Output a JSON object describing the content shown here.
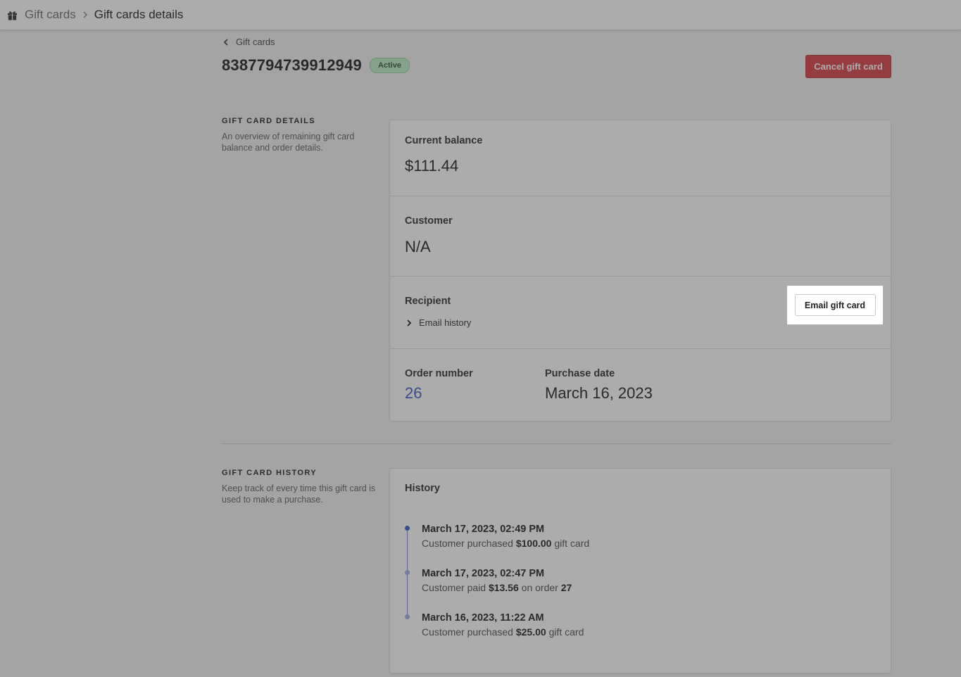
{
  "breadcrumb": {
    "root": "Gift cards",
    "current": "Gift cards details"
  },
  "back_link": "Gift cards",
  "gift_card": {
    "number": "8387794739912949",
    "status": "Active"
  },
  "actions": {
    "cancel_label": "Cancel gift card",
    "email_label": "Email gift card"
  },
  "details_section": {
    "title": "GIFT CARD DETAILS",
    "description": "An overview of remaining gift card balance and order details."
  },
  "details": {
    "balance_label": "Current balance",
    "balance_value": "$111.44",
    "customer_label": "Customer",
    "customer_value": "N/A",
    "recipient_label": "Recipient",
    "email_history_label": "Email history",
    "order_number_label": "Order number",
    "order_number_value": "26",
    "purchase_date_label": "Purchase date",
    "purchase_date_value": "March 16, 2023"
  },
  "history_section": {
    "title": "GIFT CARD HISTORY",
    "description": "Keep track of every time this gift card is used to make a purchase."
  },
  "history": {
    "title": "History",
    "entries": [
      {
        "date": "March 17, 2023, 02:49 PM",
        "pre": "Customer purchased",
        "amount": "$100.00",
        "post": "gift card",
        "order": ""
      },
      {
        "date": "March 17, 2023, 02:47 PM",
        "pre": "Customer paid",
        "amount": "$13.56",
        "post": "on order",
        "order": "27"
      },
      {
        "date": "March 16, 2023, 11:22 AM",
        "pre": "Customer purchased",
        "amount": "$25.00",
        "post": "gift card",
        "order": ""
      }
    ]
  },
  "colors": {
    "danger": "#d7333a",
    "link": "#2b4fc4",
    "success_badge": "#b7ebbf"
  },
  "icons": {
    "app": "gift-icon",
    "breadcrumb_separator": "chevron-right-icon",
    "back": "chevron-left-icon",
    "disclosure": "chevron-right-icon"
  }
}
